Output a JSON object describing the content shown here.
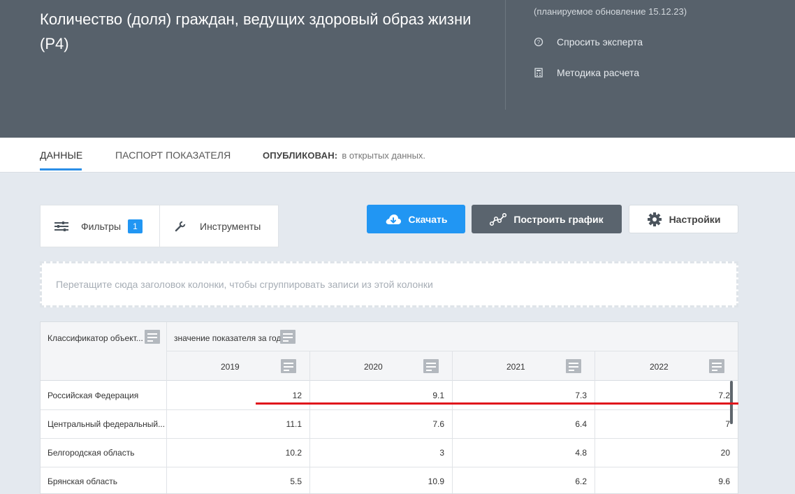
{
  "header": {
    "title": "Количество (доля) граждан, ведущих здоровый образ жизни (Р4)",
    "update_note": "(планируемое обновление 15.12.23)",
    "ask_expert": "Спросить эксперта",
    "methodology": "Методика расчета",
    "ask_expert_icon": "question-circle-icon",
    "methodology_icon": "calculator-icon"
  },
  "tabs": {
    "data": "ДАННЫЕ",
    "passport": "ПАСПОРТ ПОКАЗАТЕЛЯ",
    "published_label": "ОПУБЛИКОВАН:",
    "published_value": "в открытых данных."
  },
  "toolbar": {
    "filters_label": "Фильтры",
    "filters_count": "1",
    "tools_label": "Инструменты",
    "download_label": "Скачать",
    "chart_label": "Построить график",
    "settings_label": "Настройки",
    "accent": "#2196f3"
  },
  "grid": {
    "group_hint": "Перетащите сюда заголовок колонки, чтобы сгруппировать записи из этой колонки",
    "col_classifier": "Классификатор объект...",
    "col_group": "значение показателя за год",
    "years": [
      "2019",
      "2020",
      "2021",
      "2022"
    ],
    "rows": [
      {
        "name": "Российская Федерация",
        "values": [
          "12",
          "9.1",
          "7.3",
          "7.2"
        ]
      },
      {
        "name": "Центральный федеральный...",
        "values": [
          "11.1",
          "7.6",
          "6.4",
          "7"
        ]
      },
      {
        "name": "Белгородская область",
        "values": [
          "10.2",
          "3",
          "4.8",
          "20"
        ]
      },
      {
        "name": "Брянская область",
        "values": [
          "5.5",
          "10.9",
          "6.2",
          "9.6"
        ]
      }
    ]
  }
}
